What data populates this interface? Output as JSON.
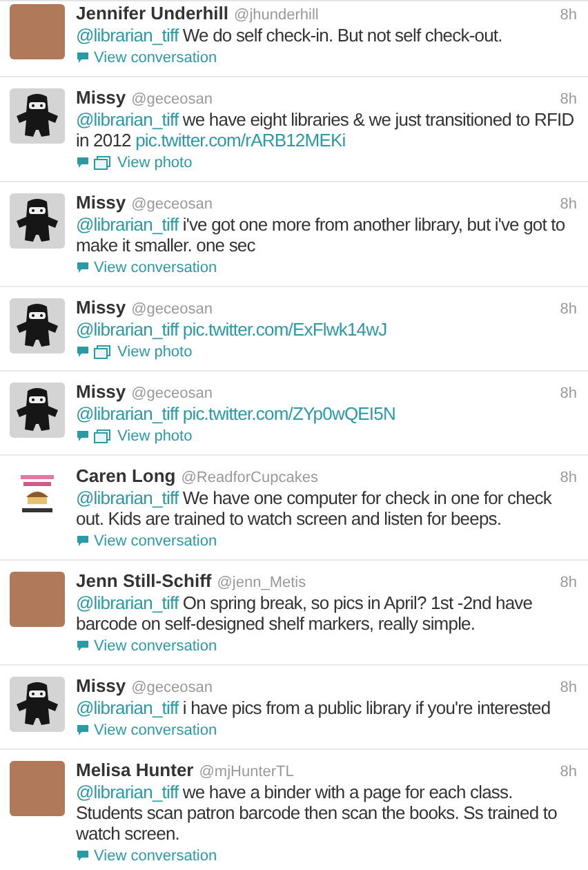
{
  "tweets": [
    {
      "avatar": {
        "kind": "photo"
      },
      "name": "Jennifer Underhill",
      "handle": "@jhunderhill",
      "time": "8h",
      "mention": "@librarian_tiff",
      "text": "We do self check-in. But not self check-out.",
      "action": {
        "kind": "conversation",
        "label": "View conversation"
      }
    },
    {
      "avatar": {
        "kind": "ninja"
      },
      "name": "Missy",
      "handle": "@geceosan",
      "time": "8h",
      "mention": "@librarian_tiff",
      "text": "we have eight libraries & we just transitioned to RFID in 2012",
      "link": "pic.twitter.com/rARB12MEKi",
      "action": {
        "kind": "photo",
        "label": "View photo"
      }
    },
    {
      "avatar": {
        "kind": "ninja"
      },
      "name": "Missy",
      "handle": "@geceosan",
      "time": "8h",
      "mention": "@librarian_tiff",
      "text": "i've got one more from another library, but i've got to make it smaller. one sec",
      "action": {
        "kind": "conversation",
        "label": "View conversation"
      }
    },
    {
      "avatar": {
        "kind": "ninja"
      },
      "name": "Missy",
      "handle": "@geceosan",
      "time": "8h",
      "mention": "@librarian_tiff",
      "link": "pic.twitter.com/ExFlwk14wJ",
      "action": {
        "kind": "photo",
        "label": "View photo"
      }
    },
    {
      "avatar": {
        "kind": "ninja"
      },
      "name": "Missy",
      "handle": "@geceosan",
      "time": "8h",
      "mention": "@librarian_tiff",
      "link": "pic.twitter.com/ZYp0wQEI5N",
      "action": {
        "kind": "photo",
        "label": "View photo"
      }
    },
    {
      "avatar": {
        "kind": "logo"
      },
      "name": "Caren Long",
      "handle": "@ReadforCupcakes",
      "time": "8h",
      "mention": "@librarian_tiff",
      "text": "We have one computer for check in one for check out. Kids are trained to watch screen and listen for beeps.",
      "action": {
        "kind": "conversation",
        "label": "View conversation"
      }
    },
    {
      "avatar": {
        "kind": "photo"
      },
      "name": "Jenn Still-Schiff",
      "handle": "@jenn_Metis",
      "time": "8h",
      "mention": "@librarian_tiff",
      "text": "On spring break, so pics in April? 1st -2nd have barcode on self-designed shelf markers, really simple.",
      "action": {
        "kind": "conversation",
        "label": "View conversation"
      }
    },
    {
      "avatar": {
        "kind": "ninja"
      },
      "name": "Missy",
      "handle": "@geceosan",
      "time": "8h",
      "mention": "@librarian_tiff",
      "text": "i have pics from a public library if you're interested",
      "action": {
        "kind": "conversation",
        "label": "View conversation"
      }
    },
    {
      "avatar": {
        "kind": "photo"
      },
      "name": "Melisa Hunter",
      "handle": "@mjHunterTL",
      "time": "8h",
      "mention": "@librarian_tiff",
      "text": "we have a binder with a page for each class. Students scan patron barcode then scan the books. Ss trained to watch screen.",
      "action": {
        "kind": "conversation",
        "label": "View conversation"
      }
    }
  ]
}
